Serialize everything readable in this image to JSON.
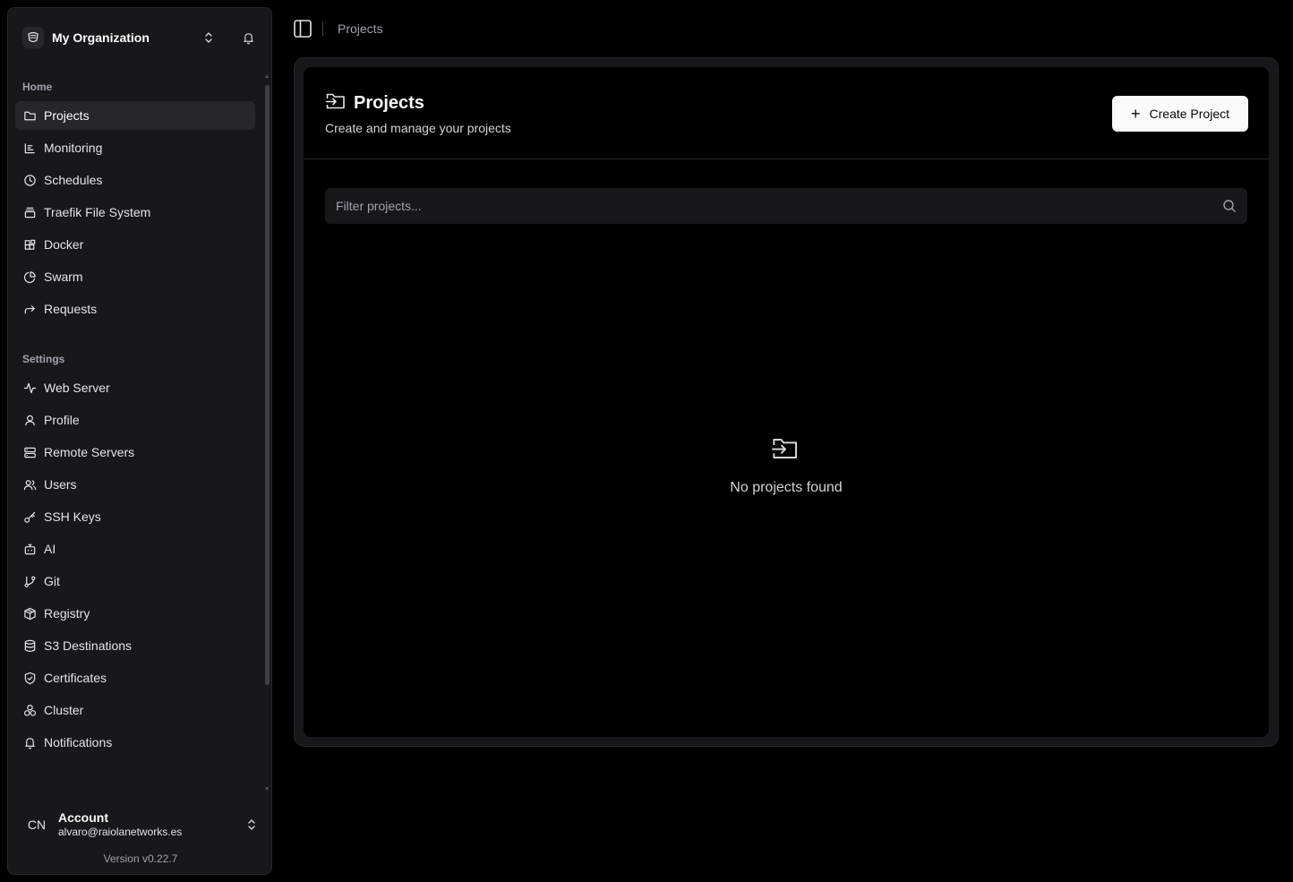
{
  "sidebar": {
    "org_name": "My Organization",
    "groups": [
      {
        "label": "Home",
        "items": [
          {
            "label": "Projects",
            "icon": "folder-icon",
            "active": true
          },
          {
            "label": "Monitoring",
            "icon": "bar-chart-icon"
          },
          {
            "label": "Schedules",
            "icon": "clock-icon"
          },
          {
            "label": "Traefik File System",
            "icon": "layers-icon"
          },
          {
            "label": "Docker",
            "icon": "blocks-icon"
          },
          {
            "label": "Swarm",
            "icon": "pie-chart-icon"
          },
          {
            "label": "Requests",
            "icon": "forward-icon"
          }
        ]
      },
      {
        "label": "Settings",
        "items": [
          {
            "label": "Web Server",
            "icon": "activity-icon"
          },
          {
            "label": "Profile",
            "icon": "user-icon"
          },
          {
            "label": "Remote Servers",
            "icon": "server-icon"
          },
          {
            "label": "Users",
            "icon": "users-icon"
          },
          {
            "label": "SSH Keys",
            "icon": "key-icon"
          },
          {
            "label": "AI",
            "icon": "bot-icon"
          },
          {
            "label": "Git",
            "icon": "git-branch-icon"
          },
          {
            "label": "Registry",
            "icon": "package-icon"
          },
          {
            "label": "S3 Destinations",
            "icon": "database-icon"
          },
          {
            "label": "Certificates",
            "icon": "shield-icon"
          },
          {
            "label": "Cluster",
            "icon": "boxes-icon"
          },
          {
            "label": "Notifications",
            "icon": "bell-icon"
          }
        ]
      }
    ],
    "account": {
      "initials": "CN",
      "title": "Account",
      "email": "alvaro@raiolanetworks.es"
    },
    "version": "Version v0.22.7"
  },
  "topbar": {
    "breadcrumb": "Projects"
  },
  "main": {
    "title": "Projects",
    "subtitle": "Create and manage your projects",
    "create_button": "Create Project",
    "filter_placeholder": "Filter projects...",
    "empty_message": "No projects found"
  },
  "colors": {
    "background": "#000000",
    "sidebar": "#18181b",
    "border": "#27272a",
    "primary_button": "#fafafa"
  }
}
